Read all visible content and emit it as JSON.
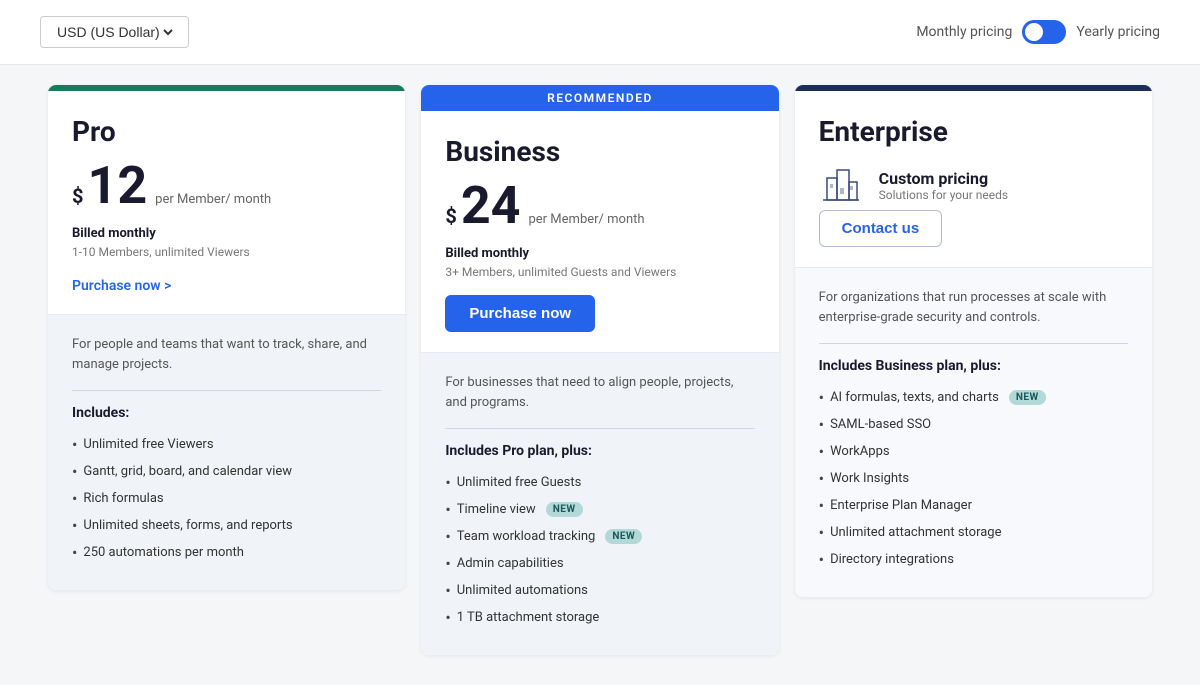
{
  "topbar": {
    "currency_label": "USD (US Dollar)",
    "monthly_label": "Monthly pricing",
    "yearly_label": "Yearly pricing"
  },
  "plans": [
    {
      "id": "pro",
      "name": "Pro",
      "recommended": false,
      "price_symbol": "$",
      "price": "12",
      "price_per": "per Member/ month",
      "billing": "Billed monthly",
      "billing_sub": "1-10 Members, unlimited Viewers",
      "cta": "Purchase now >",
      "cta_type": "text",
      "description": "For people and teams that want to track, share, and manage projects.",
      "includes_title": "Includes:",
      "features": [
        {
          "text": "Unlimited free Viewers",
          "badge": null
        },
        {
          "text": "Gantt, grid, board, and calendar view",
          "badge": null
        },
        {
          "text": "Rich formulas",
          "badge": null
        },
        {
          "text": "Unlimited sheets, forms, and reports",
          "badge": null
        },
        {
          "text": "250 automations per month",
          "badge": null
        }
      ]
    },
    {
      "id": "business",
      "name": "Business",
      "recommended": true,
      "recommended_label": "RECOMMENDED",
      "price_symbol": "$",
      "price": "24",
      "price_per": "per Member/ month",
      "billing": "Billed monthly",
      "billing_sub": "3+ Members, unlimited Guests and Viewers",
      "cta": "Purchase now",
      "cta_type": "filled",
      "description": "For businesses that need to align people, projects, and programs.",
      "includes_title": "Includes Pro plan, plus:",
      "features": [
        {
          "text": "Unlimited free Guests",
          "badge": null
        },
        {
          "text": "Timeline view",
          "badge": "NEW"
        },
        {
          "text": "Team workload tracking",
          "badge": "NEW"
        },
        {
          "text": "Admin capabilities",
          "badge": null
        },
        {
          "text": "Unlimited automations",
          "badge": null
        },
        {
          "text": "1 TB attachment storage",
          "badge": null
        }
      ]
    },
    {
      "id": "enterprise",
      "name": "Enterprise",
      "recommended": false,
      "price_symbol": null,
      "price": null,
      "price_per": null,
      "billing": "Custom pricing",
      "billing_sub": "Solutions for your needs",
      "cta": "Contact us",
      "cta_type": "outline",
      "description": "For organizations that run processes at scale with enterprise-grade security and controls.",
      "includes_title": "Includes Business plan, plus:",
      "features": [
        {
          "text": "AI formulas, texts, and charts",
          "badge": "NEW"
        },
        {
          "text": "SAML-based SSO",
          "badge": null
        },
        {
          "text": "WorkApps",
          "badge": null
        },
        {
          "text": "Work Insights",
          "badge": null
        },
        {
          "text": "Enterprise Plan Manager",
          "badge": null
        },
        {
          "text": "Unlimited attachment storage",
          "badge": null
        },
        {
          "text": "Directory integrations",
          "badge": null
        }
      ]
    }
  ]
}
